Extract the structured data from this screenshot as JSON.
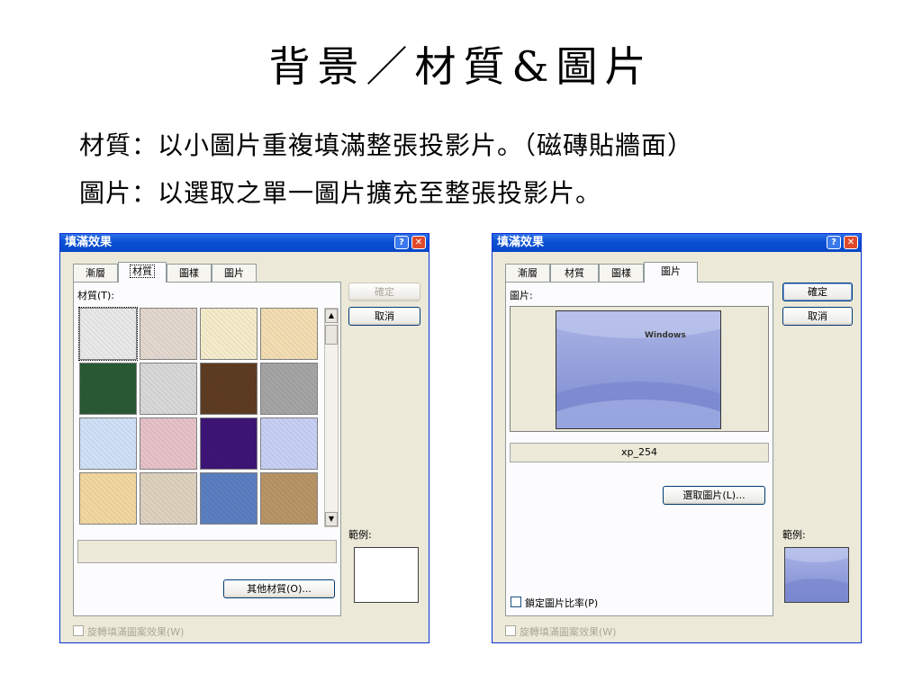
{
  "slide": {
    "title": "背景／材質&圖片",
    "line1": "材質：以小圖片重複填滿整張投影片。（磁磚貼牆面）",
    "line2": "圖片：以選取之單一圖片擴充至整張投影片。"
  },
  "dialog_texture": {
    "title": "填滿效果",
    "tabs": [
      "漸層",
      "材質",
      "圖樣",
      "圖片"
    ],
    "texture_label": "材質(T):",
    "ok": "確定",
    "cancel": "取消",
    "texture_name": "",
    "other_texture": "其他材質(O)...",
    "sample_label": "範例:",
    "rotate_checkbox": "旋轉填滿圖案效果(W)",
    "swatch_colors": [
      "#e9e9e9",
      "#e3d8cf",
      "#f5eccb",
      "#f3ddb2",
      "#2a5a35",
      "#d8d8d8",
      "#5e3c22",
      "#a5a5a5",
      "#cfe1f7",
      "#e6c2c8",
      "#3e1576",
      "#c7d0f4",
      "#f2d79f",
      "#ddd2be",
      "#5b7fc1",
      "#b89566"
    ]
  },
  "dialog_picture": {
    "title": "填滿效果",
    "tabs": [
      "漸層",
      "材質",
      "圖樣",
      "圖片"
    ],
    "picture_label": "圖片:",
    "ok": "確定",
    "cancel": "取消",
    "file_name": "xp_254",
    "select_picture": "選取圖片(L)...",
    "sample_label": "範例:",
    "lock_ratio": "鎖定圖片比率(P)",
    "rotate_checkbox": "旋轉填滿圖案效果(W)",
    "logo_text": "Windows"
  },
  "colors": {
    "titlebar": "#0a4fd4",
    "dialog_bg": "#ece9d8"
  }
}
